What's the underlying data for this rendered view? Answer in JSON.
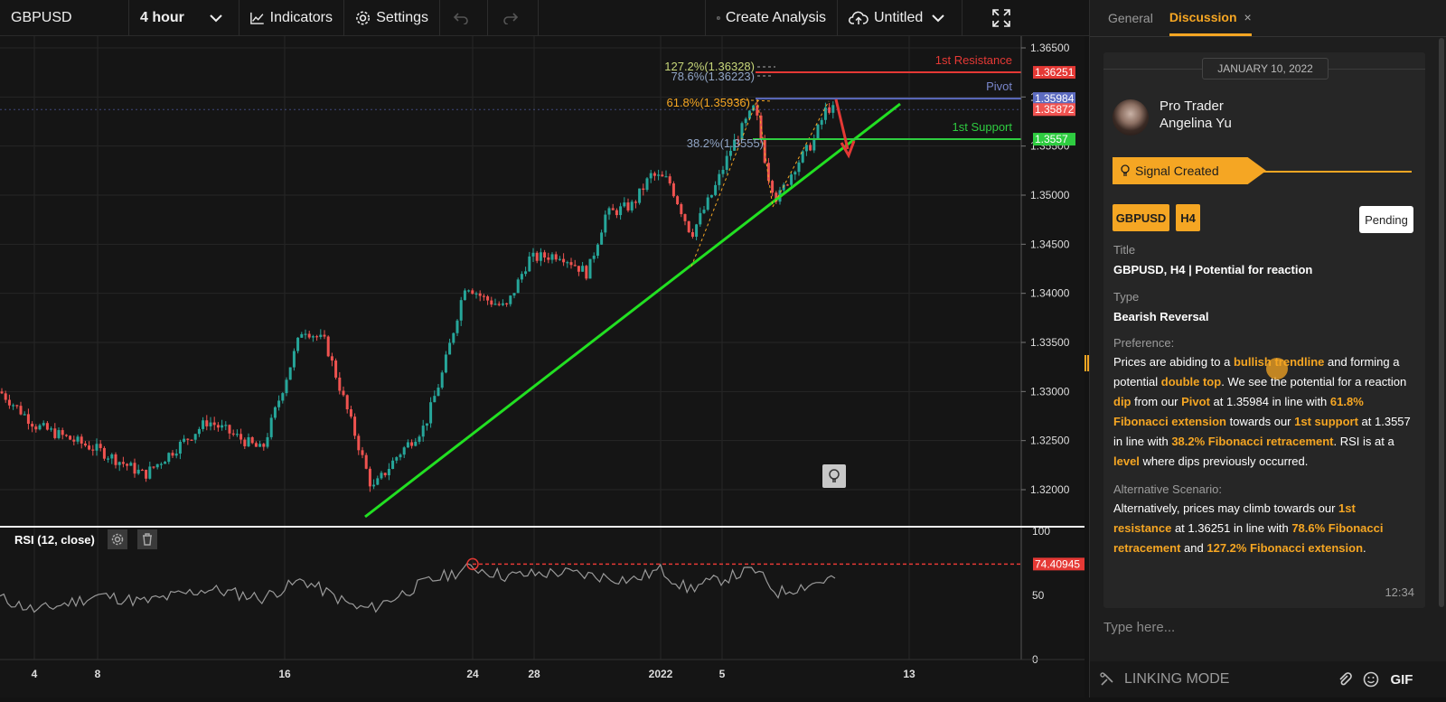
{
  "toolbar": {
    "symbol": "GBPUSD",
    "interval": "4 hour",
    "indicators_label": "Indicators",
    "settings_label": "Settings",
    "create_label": "Create Analysis",
    "file_label": "Untitled"
  },
  "chart": {
    "price_ticks": [
      "1.36500",
      "1.36000",
      "1.35500",
      "1.35000",
      "1.34500",
      "1.34000",
      "1.33500",
      "1.33000",
      "1.32500",
      "1.32000"
    ],
    "x_ticks": [
      "4",
      "8",
      "16",
      "24",
      "28",
      "2022",
      "5",
      "13"
    ],
    "resistance_label": "1st Resistance",
    "resistance_value": "1.36251",
    "pivot_label": "Pivot",
    "pivot_value": "1.35984",
    "current_value": "1.35872",
    "support_label": "1st Support",
    "support_value": "1.3557",
    "fib_1272": "127.2%(1.36328)",
    "fib_786": "78.6%(1.36223)",
    "fib_618": "61.8%(1.35936)",
    "fib_382": "38.2%(1.3555)",
    "rsi_label": "RSI (12, close)",
    "rsi_ticks": [
      "100",
      "50",
      "0"
    ],
    "rsi_value": "74.40945",
    "colors": {
      "up": "#26a69a",
      "down": "#ef5350",
      "trend": "#22e022",
      "resistance": "#e53935",
      "pivot": "#5c6bc0",
      "support": "#2ecc40",
      "fib": "#f5a623"
    }
  },
  "side": {
    "tab_general": "General",
    "tab_discussion": "Discussion",
    "tab_close": "×",
    "date": "JANUARY 10, 2022",
    "role": "Pro Trader",
    "name": "Angelina Yu",
    "signal": "Signal Created",
    "tag_symbol": "GBPUSD",
    "tag_tf": "H4",
    "status": "Pending",
    "title_label": "Title",
    "title_value": "GBPUSD, H4 | Potential for reaction",
    "type_label": "Type",
    "type_value": "Bearish Reversal",
    "pref_label": "Preference:",
    "pref": {
      "p1": "Prices are abiding to a ",
      "h1": "bullish trendline",
      "p2": " and forming a potential ",
      "h2": "double top",
      "p3": ". We see the potential for a reaction ",
      "h3": "dip",
      "p4": " from our ",
      "h4": "Pivot",
      "p5": " at 1.35984 in line with ",
      "h5": "61.8% Fibonacci extension",
      "p6": " towards our ",
      "h6": "1st support",
      "p7": " at 1.3557 in line with ",
      "h7": "38.2% Fibonacci retracement",
      "p8": ". RSI is at a ",
      "h8": "level",
      "p9": " where dips previously occurred."
    },
    "alt_label": "Alternative Scenario:",
    "alt": {
      "p1": "Alternatively, prices may climb towards our ",
      "h1": "1st resistance",
      "p2": " at 1.36251 in line with ",
      "h2": "78.6% Fibonacci retracement",
      "p3": " and ",
      "h3": "127.2% Fibonacci extension",
      "p4": "."
    },
    "time": "12:34",
    "input_placeholder": "Type here...",
    "linking_mode": "LINKING MODE",
    "gif": "GIF"
  }
}
